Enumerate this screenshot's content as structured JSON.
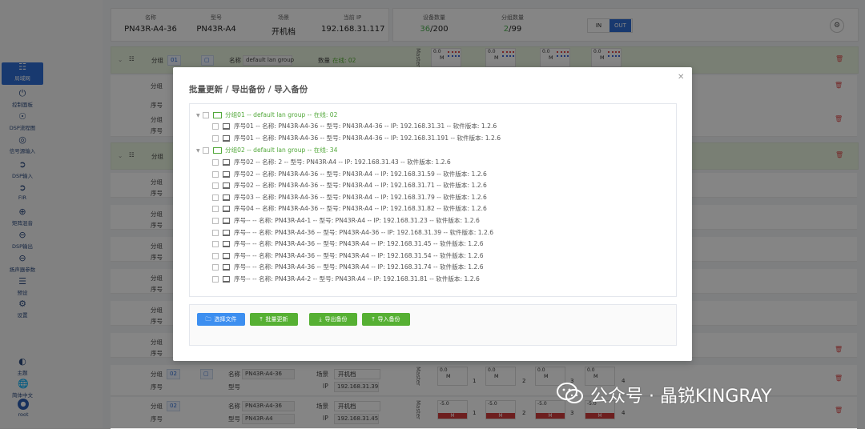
{
  "header": {
    "columns": [
      {
        "key": "名称",
        "value": "PN43R-A4-36"
      },
      {
        "key": "型号",
        "value": "PN43R-A4"
      },
      {
        "key": "场景",
        "value": "开机档"
      },
      {
        "key": "当前 IP",
        "value": "192.168.31.117"
      }
    ],
    "device_count_label": "设备数量",
    "device_count": "36",
    "device_total": "/200",
    "group_count_label": "分组数量",
    "group_count": "2",
    "group_total": "/99",
    "io_in": "IN",
    "io_out": "OUT"
  },
  "sidebar": {
    "items": [
      {
        "label": "局域网",
        "icon": "network-icon",
        "active": true
      },
      {
        "label": "控制面板",
        "icon": "power-icon"
      },
      {
        "label": "DSP流程图",
        "icon": "flow-icon"
      },
      {
        "label": "信号源输入",
        "icon": "signal-icon"
      },
      {
        "label": "DSP输入",
        "icon": "input-icon"
      },
      {
        "label": "FIR",
        "icon": "fir-icon"
      },
      {
        "label": "矩阵混音",
        "icon": "matrix-icon"
      },
      {
        "label": "DSP输出",
        "icon": "output-icon"
      },
      {
        "label": "扬声器参数",
        "icon": "speaker-icon"
      },
      {
        "label": "预设",
        "icon": "preset-icon"
      },
      {
        "label": "设置",
        "icon": "gear-icon"
      },
      {
        "label": "主题",
        "icon": "theme-icon"
      },
      {
        "label": "简体中文",
        "icon": "language-icon"
      }
    ],
    "user": "root"
  },
  "background": {
    "group_label": "分组",
    "group_id": "01",
    "name_label": "名称",
    "group_name": "default lan group",
    "count_label": "数量",
    "online_text": "在线: 02",
    "seq_label": "序号",
    "model_label": "型号",
    "scene_label": "场景",
    "ip_label": "IP",
    "row_group_id": "02",
    "row1_name": "PN43R-A4-36",
    "row1_scene": "开机档",
    "row1_ip": "192.168.31.39",
    "row2_name": "PN43R-A4-36",
    "row2_scene": "开机档",
    "row2_ip": "192.168.31.45",
    "row2_model": "PN43R-A4",
    "master": "Master",
    "meter_top": "0.0",
    "meter_mute": "M",
    "meter_neg": "-5.0",
    "ch": [
      "1",
      "2",
      "3",
      "4"
    ]
  },
  "modal": {
    "title": "批量更新 / 导出备份 / 导入备份",
    "groups": [
      {
        "text": "分组01 -- default lan group -- 在线: 02",
        "devices": [
          "序号01 -- 名称: PN43R-A4-36 -- 型号: PN43R-A4-36 -- IP: 192.168.31.31 -- 软件版本: 1.2.6",
          "序号01 -- 名称: PN43R-A4-36 -- 型号: PN43R-A4-36 -- IP: 192.168.31.191 -- 软件版本: 1.2.6"
        ]
      },
      {
        "text": "分组02 -- default lan group -- 在线: 34",
        "devices": [
          "序号02 -- 名称: 2 -- 型号: PN43R-A4 -- IP: 192.168.31.43 -- 软件版本: 1.2.6",
          "序号02 -- 名称: PN43R-A4-36 -- 型号: PN43R-A4 -- IP: 192.168.31.59 -- 软件版本: 1.2.6",
          "序号02 -- 名称: PN43R-A4-36 -- 型号: PN43R-A4 -- IP: 192.168.31.71 -- 软件版本: 1.2.6",
          "序号03 -- 名称: PN43R-A4-36 -- 型号: PN43R-A4 -- IP: 192.168.31.79 -- 软件版本: 1.2.6",
          "序号04 -- 名称: PN43R-A4-36 -- 型号: PN43R-A4 -- IP: 192.168.31.82 -- 软件版本: 1.2.6",
          "序号-- -- 名称: PN43R-A4-1 -- 型号: PN43R-A4 -- IP: 192.168.31.23 -- 软件版本: 1.2.6",
          "序号-- -- 名称: PN43R-A4-36 -- 型号: PN43R-A4-36 -- IP: 192.168.31.39 -- 软件版本: 1.2.6",
          "序号-- -- 名称: PN43R-A4-36 -- 型号: PN43R-A4 -- IP: 192.168.31.45 -- 软件版本: 1.2.6",
          "序号-- -- 名称: PN43R-A4-36 -- 型号: PN43R-A4 -- IP: 192.168.31.54 -- 软件版本: 1.2.6",
          "序号-- -- 名称: PN43R-A4-36 -- 型号: PN43R-A4 -- IP: 192.168.31.74 -- 软件版本: 1.2.6",
          "序号-- -- 名称: PN43R-A4-2 -- 型号: PN43R-A4 -- IP: 192.168.31.81 -- 软件版本: 1.2.6"
        ]
      }
    ],
    "buttons": {
      "select_file": "选择文件",
      "batch_update": "批量更新",
      "export_backup": "导出备份",
      "import_backup": "导入备份"
    }
  },
  "watermark": {
    "text": "公众号 · 晶锐KINGRAY"
  },
  "colors": {
    "accent": "#2f6ed5",
    "green": "#56b033",
    "blue_button": "#3d8ff0"
  }
}
